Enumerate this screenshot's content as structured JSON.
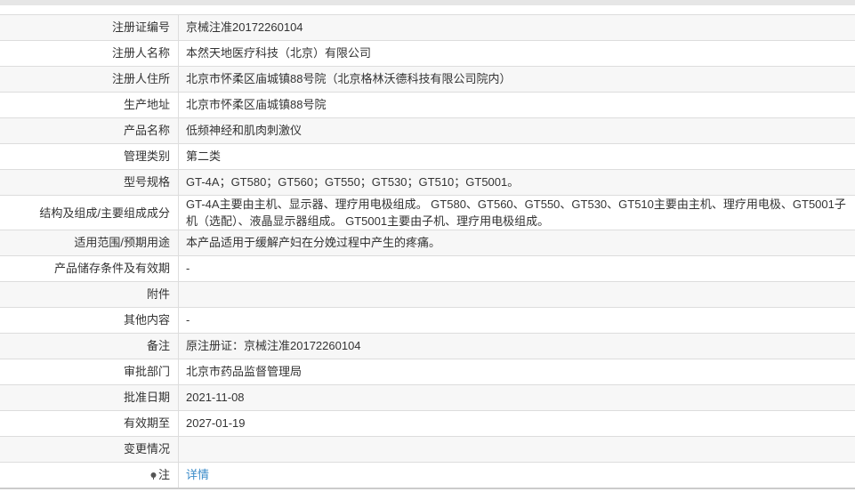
{
  "rows": [
    {
      "label": "注册证编号",
      "value": "京械注准20172260104"
    },
    {
      "label": "注册人名称",
      "value": "本然天地医疗科技（北京）有限公司"
    },
    {
      "label": "注册人住所",
      "value": "北京市怀柔区庙城镇88号院（北京格林沃德科技有限公司院内）"
    },
    {
      "label": "生产地址",
      "value": "北京市怀柔区庙城镇88号院"
    },
    {
      "label": "产品名称",
      "value": "低频神经和肌肉刺激仪"
    },
    {
      "label": "管理类别",
      "value": "第二类"
    },
    {
      "label": "型号规格",
      "value": "GT-4A；GT580；GT560；GT550；GT530；GT510；GT5001。"
    },
    {
      "label": "结构及组成/主要组成成分",
      "value": "GT-4A主要由主机、显示器、理疗用电极组成。 GT580、GT560、GT550、GT530、GT510主要由主机、理疗用电极、GT5001子机（选配）、液晶显示器组成。 GT5001主要由子机、理疗用电极组成。"
    },
    {
      "label": "适用范围/预期用途",
      "value": "本产品适用于缓解产妇在分娩过程中产生的疼痛。"
    },
    {
      "label": "产品储存条件及有效期",
      "value": "-"
    },
    {
      "label": "附件",
      "value": ""
    },
    {
      "label": "其他内容",
      "value": "-"
    },
    {
      "label": "备注",
      "value": "原注册证：京械注准20172260104"
    },
    {
      "label": "审批部门",
      "value": "北京市药品监督管理局"
    },
    {
      "label": "批准日期",
      "value": "2021-11-08"
    },
    {
      "label": "有效期至",
      "value": "2027-01-19"
    },
    {
      "label": "变更情况",
      "value": ""
    },
    {
      "label": "注",
      "value": "详情",
      "icon": "pin-icon",
      "link_color": "#3b8cc9"
    }
  ]
}
